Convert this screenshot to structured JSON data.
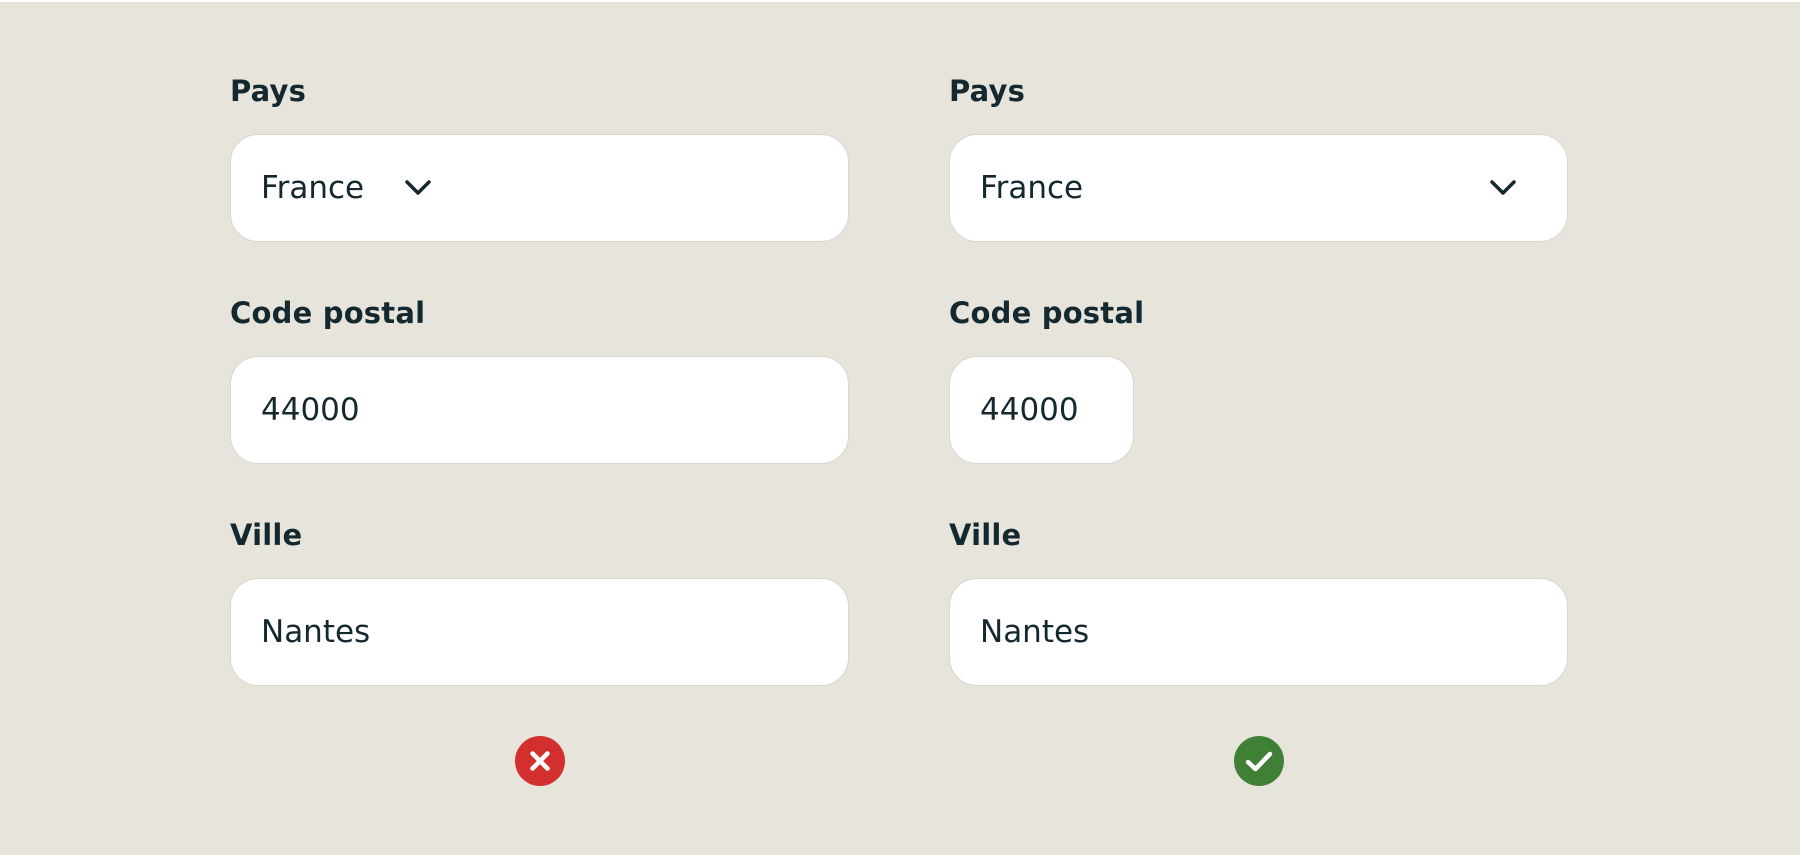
{
  "examples": [
    {
      "id": "bad",
      "country": {
        "label": "Pays",
        "value": "France"
      },
      "postal_code": {
        "label": "Code postal",
        "value": "44000"
      },
      "city": {
        "label": "Ville",
        "value": "Nantes"
      },
      "status": {
        "icon": "cross-icon",
        "color": "#d32f2f"
      }
    },
    {
      "id": "good",
      "country": {
        "label": "Pays",
        "value": "France"
      },
      "postal_code": {
        "label": "Code postal",
        "value": "44000"
      },
      "city": {
        "label": "Ville",
        "value": "Nantes"
      },
      "status": {
        "icon": "check-icon",
        "color": "#3f7f36"
      }
    }
  ]
}
